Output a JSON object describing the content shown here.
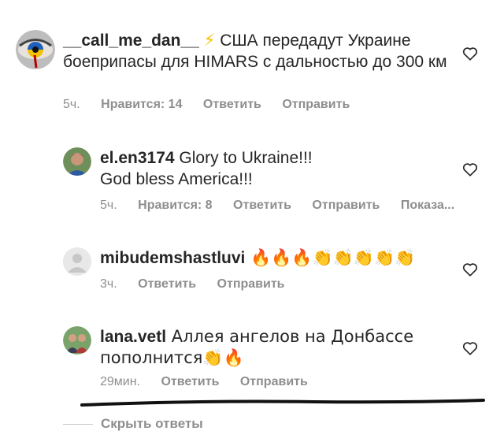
{
  "comments": [
    {
      "user": "__call_me_dan__",
      "emoji": "⚡",
      "text": " США передадут Украине боеприпасы для HIMARS с дальностью до 300 км",
      "time": "5ч.",
      "likes": "Нравится: 14",
      "reply": "Ответить",
      "send": "Отправить"
    },
    {
      "user": "el.en3174",
      "text": " Glory to Ukraine!!! God bless America!!!",
      "time": "5ч.",
      "likes": "Нравится: 8",
      "reply": "Ответить",
      "send": "Отправить",
      "more": "Показа..."
    },
    {
      "user": "mibudemshastluvi",
      "text": " 🔥🔥🔥👏👏👏👏👏",
      "time": "3ч.",
      "reply": "Ответить",
      "send": "Отправить"
    },
    {
      "user": "lana.vetl",
      "text": " Аллея ангелов на Донбассе пополнится👏🔥",
      "time": "29мин.",
      "reply": "Ответить",
      "send": "Отправить"
    }
  ],
  "hide_replies": "Скрыть ответы",
  "icons": [
    "heart-icon"
  ],
  "colors": {
    "text": "#262626",
    "meta": "#8e8e8e"
  }
}
